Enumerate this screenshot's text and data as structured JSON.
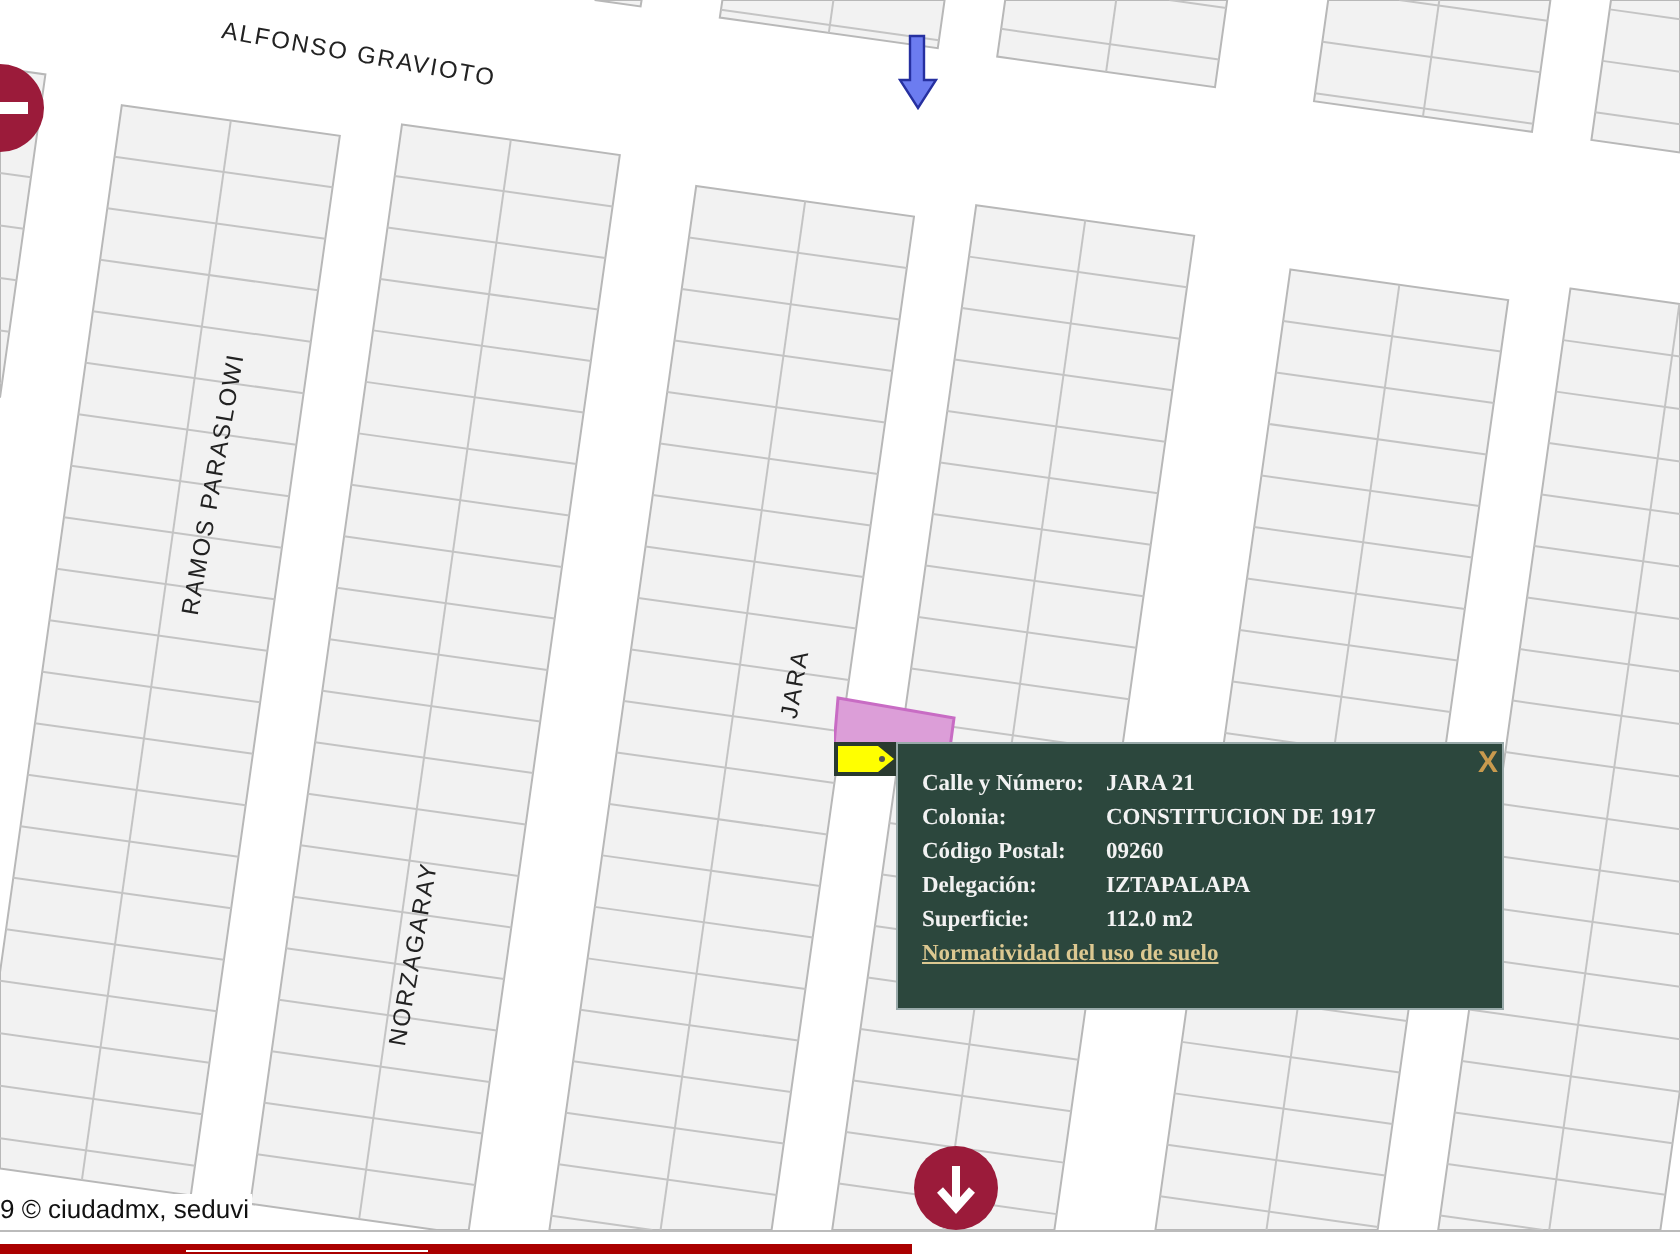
{
  "map": {
    "streets": [
      {
        "name": "ALFONSO GRAVIOTO",
        "kind": "horizontal"
      },
      {
        "name": "RAMOS PARASLOWI",
        "kind": "vertical"
      },
      {
        "name": "NORZAGARAY",
        "kind": "vertical"
      },
      {
        "name": "JARA",
        "kind": "vertical"
      }
    ],
    "attribution": "9 © ciudadmx, seduvi"
  },
  "popup": {
    "close": "X",
    "fields": [
      {
        "label": "Calle y Número:",
        "value": "JARA 21"
      },
      {
        "label": "Colonia:",
        "value": "CONSTITUCION DE 1917"
      },
      {
        "label": "Código Postal:",
        "value": "09260"
      },
      {
        "label": "Delegación:",
        "value": "IZTAPALAPA"
      },
      {
        "label": "Superficie:",
        "value": "112.0 m2"
      }
    ],
    "link": "Normatividad del uso de suelo"
  }
}
